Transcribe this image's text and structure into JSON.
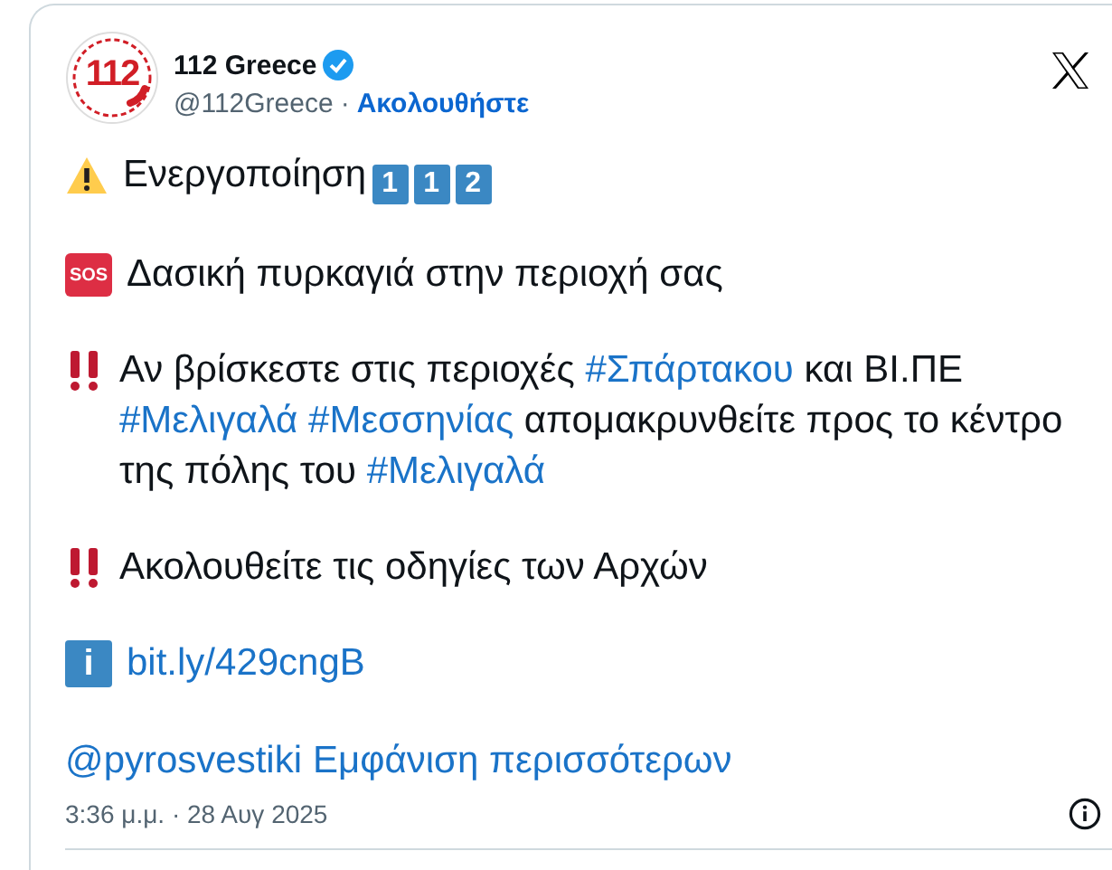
{
  "account": {
    "name": "112 Greece",
    "verified": true,
    "handle": "@112Greece",
    "separator": "·",
    "follow": "Ακολουθήστε",
    "avatar_text": "112"
  },
  "paragraphs": [
    {
      "kind": "warning",
      "lines": [
        [
          {
            "kind": "text",
            "text": "Ενεργοποίηση"
          }
        ]
      ],
      "keycaps": [
        "1",
        "1",
        "2"
      ]
    },
    {
      "kind": "sos",
      "icon_text": "SOS",
      "lines": [
        [
          {
            "kind": "text",
            "text": "Δασική πυρκαγιά στην περιοχή σας"
          }
        ]
      ]
    },
    {
      "kind": "bangbang",
      "lines": [
        [
          {
            "kind": "text",
            "text": "Αν βρίσκεστε στις περιοχές "
          },
          {
            "kind": "link",
            "text": "#Σπάρτακου"
          },
          {
            "kind": "text",
            "text": " και ΒΙ.ΠΕ"
          }
        ],
        [
          {
            "kind": "link",
            "text": "#Μελιγαλά"
          },
          {
            "kind": "space"
          },
          {
            "kind": "link",
            "text": "#Μεσσηνίας"
          },
          {
            "kind": "text",
            "text": " απομακρυνθείτε προς το κέντρο"
          }
        ],
        [
          {
            "kind": "text",
            "text": "της πόλης του "
          },
          {
            "kind": "link",
            "text": "#Μελιγαλά"
          }
        ]
      ]
    },
    {
      "kind": "bangbang",
      "lines": [
        [
          {
            "kind": "text",
            "text": "Ακολουθείτε τις οδηγίες των Αρχών"
          }
        ]
      ]
    },
    {
      "kind": "info",
      "icon_text": "i",
      "lines": [
        [
          {
            "kind": "link",
            "text": "bit.ly/429cngB"
          }
        ]
      ]
    }
  ],
  "more": {
    "mention": "@pyrosvestiki",
    "show_more": "Εμφάνιση περισσότερων"
  },
  "timestamp": "3:36 μ.μ. · 28 Αυγ 2025"
}
